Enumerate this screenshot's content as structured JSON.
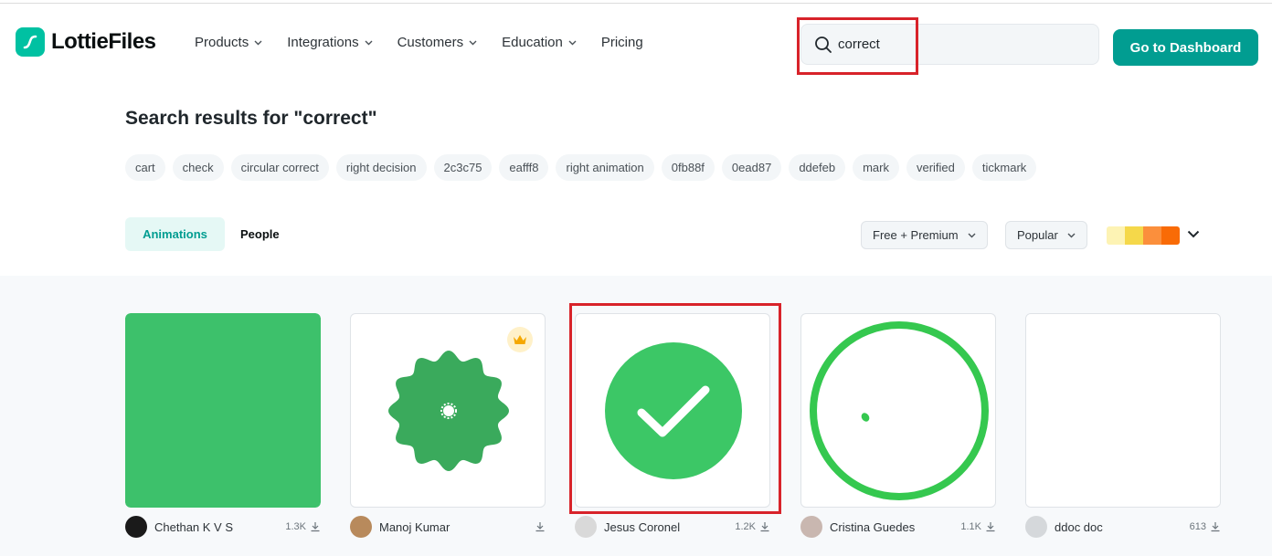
{
  "brand": {
    "name": "LottieFiles",
    "color": "#00c1a2"
  },
  "nav": [
    {
      "label": "Products",
      "has_dropdown": true
    },
    {
      "label": "Integrations",
      "has_dropdown": true
    },
    {
      "label": "Customers",
      "has_dropdown": true
    },
    {
      "label": "Education",
      "has_dropdown": true
    },
    {
      "label": "Pricing",
      "has_dropdown": false
    }
  ],
  "search": {
    "value": "correct",
    "icon": "search-icon"
  },
  "dashboard_button": {
    "label": "Go to Dashboard",
    "color": "#019d91"
  },
  "results": {
    "title": "Search results for \"correct\"",
    "tags": [
      "cart",
      "check",
      "circular correct",
      "right decision",
      "2c3c75",
      "eafff8",
      "right animation",
      "0fb88f",
      "0ead87",
      "ddefeb",
      "mark",
      "verified",
      "tickmark"
    ]
  },
  "tabs": {
    "animations": "Animations",
    "people": "People",
    "active": "Animations"
  },
  "filters": {
    "license": "Free + Premium",
    "sort": "Popular",
    "palette": [
      "#fdf3b4",
      "#f5d84a",
      "#fb8f3c",
      "#f96b06"
    ]
  },
  "cards": [
    {
      "author": "Chethan K V S",
      "downloads": "1.3K",
      "preview": "green-square",
      "premium": false
    },
    {
      "author": "Manoj Kumar",
      "downloads": "",
      "preview": "green-badge",
      "premium": true
    },
    {
      "author": "Jesus Coronel",
      "downloads": "1.2K",
      "preview": "green-checkmark",
      "premium": false
    },
    {
      "author": "Cristina Guedes",
      "downloads": "1.1K",
      "preview": "green-ring",
      "premium": false
    },
    {
      "author": "ddoc doc",
      "downloads": "613",
      "preview": "blank",
      "premium": false
    }
  ]
}
